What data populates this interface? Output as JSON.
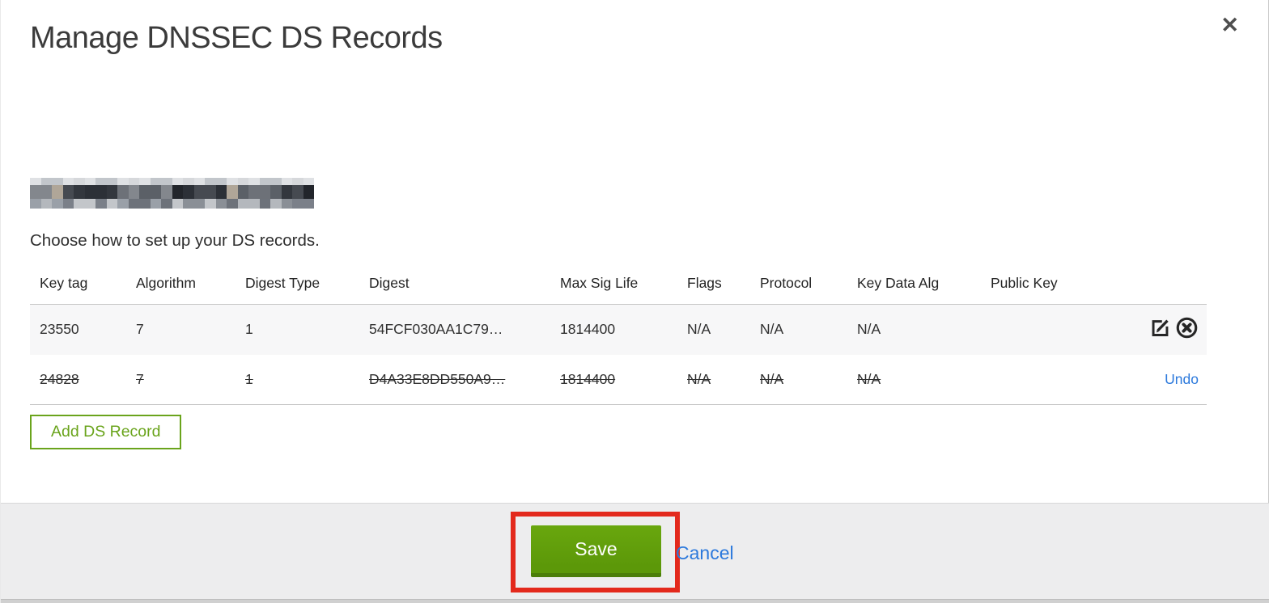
{
  "modal": {
    "title": "Manage DNSSEC DS Records",
    "close_glyph": "✕",
    "instruction": "Choose how to set up your DS records.",
    "add_button_label": "Add DS Record",
    "save_label": "Save",
    "cancel_label": "Cancel"
  },
  "table": {
    "columns": [
      "Key tag",
      "Algorithm",
      "Digest Type",
      "Digest",
      "Max Sig Life",
      "Flags",
      "Protocol",
      "Key Data Alg",
      "Public Key"
    ],
    "rows": [
      {
        "key_tag": "23550",
        "algorithm": "7",
        "digest_type": "1",
        "digest": "54FCF030AA1C79…",
        "max_sig_life": "1814400",
        "flags": "N/A",
        "protocol": "N/A",
        "key_data_alg": "N/A",
        "public_key": "",
        "state": "current"
      },
      {
        "key_tag": "24828",
        "algorithm": "7",
        "digest_type": "1",
        "digest": "D4A33E8DD550A9…",
        "max_sig_life": "1814400",
        "flags": "N/A",
        "protocol": "N/A",
        "key_data_alg": "N/A",
        "public_key": "",
        "state": "deleted",
        "undo_label": "Undo"
      }
    ]
  },
  "colors": {
    "accent_green": "#6aa41c",
    "save_button_green": "#5c9809",
    "link_blue": "#2c79dc",
    "annotation_red": "#e3291c"
  }
}
